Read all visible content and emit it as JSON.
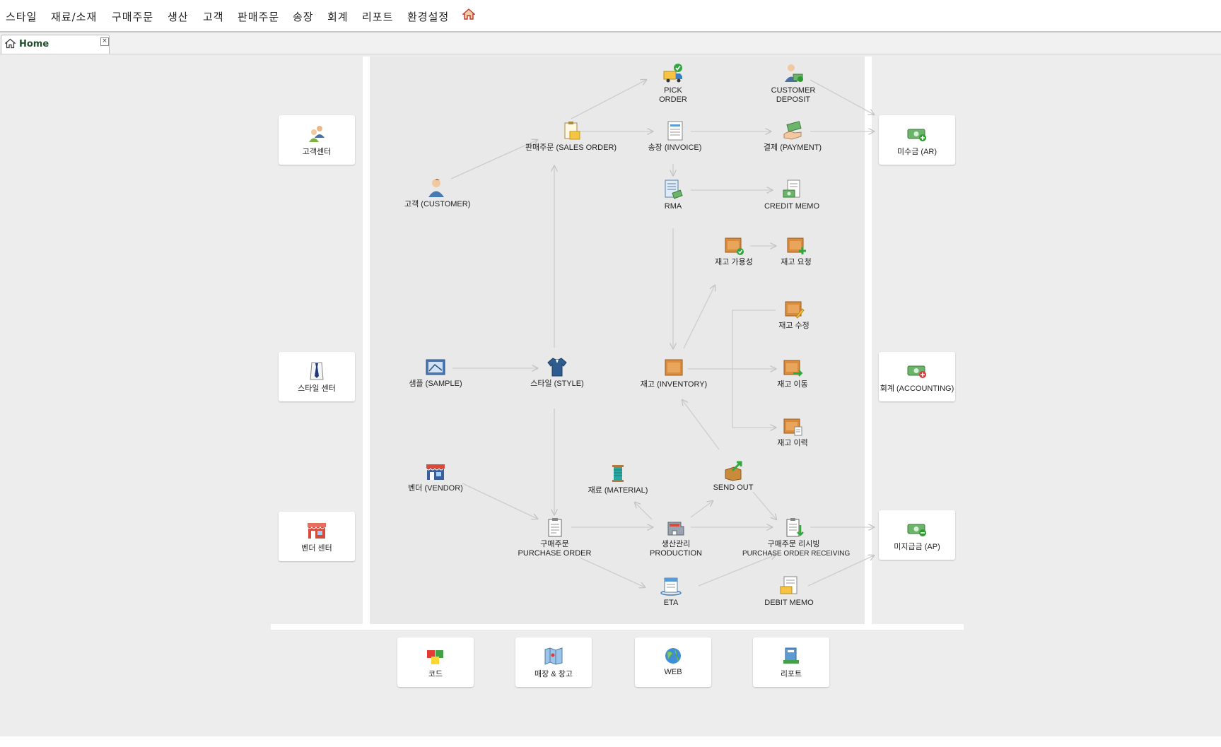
{
  "menu": [
    "스타일",
    "재료/소재",
    "구매주문",
    "생산",
    "고객",
    "판매주문",
    "송장",
    "회계",
    "리포트",
    "환경설정"
  ],
  "tab": {
    "label": "Home",
    "close": "×"
  },
  "side_cards": {
    "customer_center": "고객센터",
    "style_center": "스타일 센터",
    "vendor_center": "벤더 센터",
    "ar": "미수금 (AR)",
    "accounting": "회계 (ACCOUNTING)",
    "ap": "미지급금 (AP)"
  },
  "bottom_cards": {
    "code": "코드",
    "store_warehouse": "매장 & 창고",
    "web": "WEB",
    "report": "리포트"
  },
  "flow": {
    "pick_order": [
      "PICK",
      "ORDER"
    ],
    "customer_deposit": [
      "CUSTOMER",
      "DEPOSIT"
    ],
    "sales_order": "판매주문 (SALES ORDER)",
    "invoice": "송장 (INVOICE)",
    "payment": "결제 (PAYMENT)",
    "customer": "고객 (CUSTOMER)",
    "rma": "RMA",
    "credit_memo": "CREDIT MEMO",
    "stock_availability": "재고 가용성",
    "stock_request": "재고 요청",
    "stock_adjust": "재고 수정",
    "sample": "샘플 (SAMPLE)",
    "style": "스타일 (STYLE)",
    "inventory": "재고 (INVENTORY)",
    "stock_transfer": "재고 이동",
    "stock_history": "재고 이력",
    "vendor": "벤더 (VENDOR)",
    "material": "재료 (MATERIAL)",
    "send_out": "SEND OUT",
    "purchase_order": [
      "구매주문",
      "PURCHASE ORDER"
    ],
    "production": [
      "생산관리",
      "PRODUCTION"
    ],
    "po_receiving": [
      "구매주문 리시빙",
      "PURCHASE ORDER RECEIVING"
    ],
    "eta": "ETA",
    "debit_memo": "DEBIT MEMO"
  }
}
